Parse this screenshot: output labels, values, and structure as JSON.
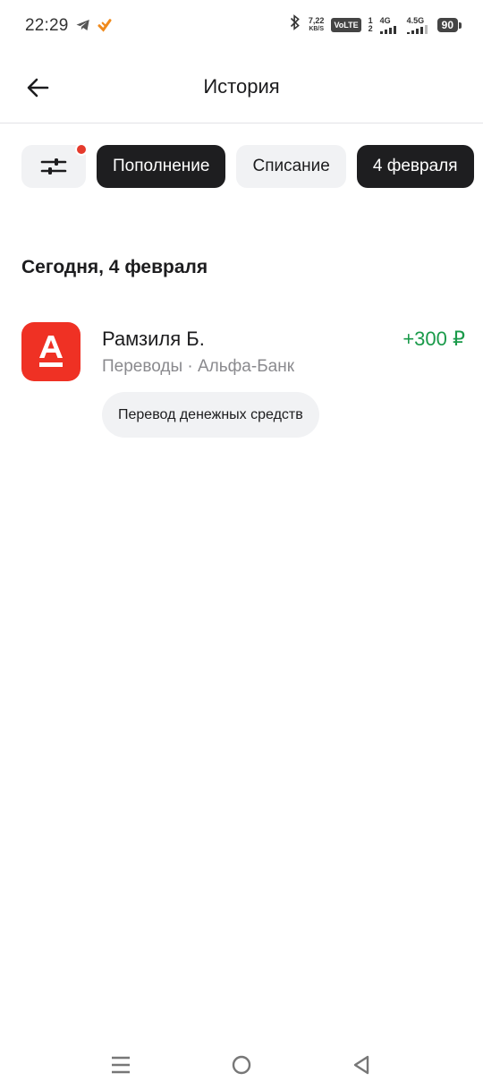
{
  "status_bar": {
    "time": "22:29",
    "speed_value": "7,22",
    "speed_unit": "KB/S",
    "volte": "VoLTE",
    "sim1": "1",
    "sim2": "2",
    "net1": "4G",
    "net2": "4.5G",
    "battery": "90"
  },
  "header": {
    "title": "История",
    "back_icon": "arrow-left-icon"
  },
  "filters": {
    "filter_icon": "sliders-icon",
    "has_indicator": true,
    "chips": [
      {
        "label": "Пополнение",
        "active": true
      },
      {
        "label": "Списание",
        "active": false
      },
      {
        "label": "4 февраля",
        "active": true
      }
    ]
  },
  "section": {
    "date_label": "Сегодня, 4 февраля"
  },
  "transaction": {
    "name": "Рамзиля Б.",
    "subtitle": "Переводы · Альфа-Банк",
    "amount": "+300 ₽",
    "tag": "Перевод денежных средств",
    "logo_letter": "А"
  },
  "colors": {
    "accent_dark": "#1e1e20",
    "brand_red": "#ef3124",
    "positive_green": "#1a9a4a",
    "indicator_red": "#e53a2c"
  }
}
